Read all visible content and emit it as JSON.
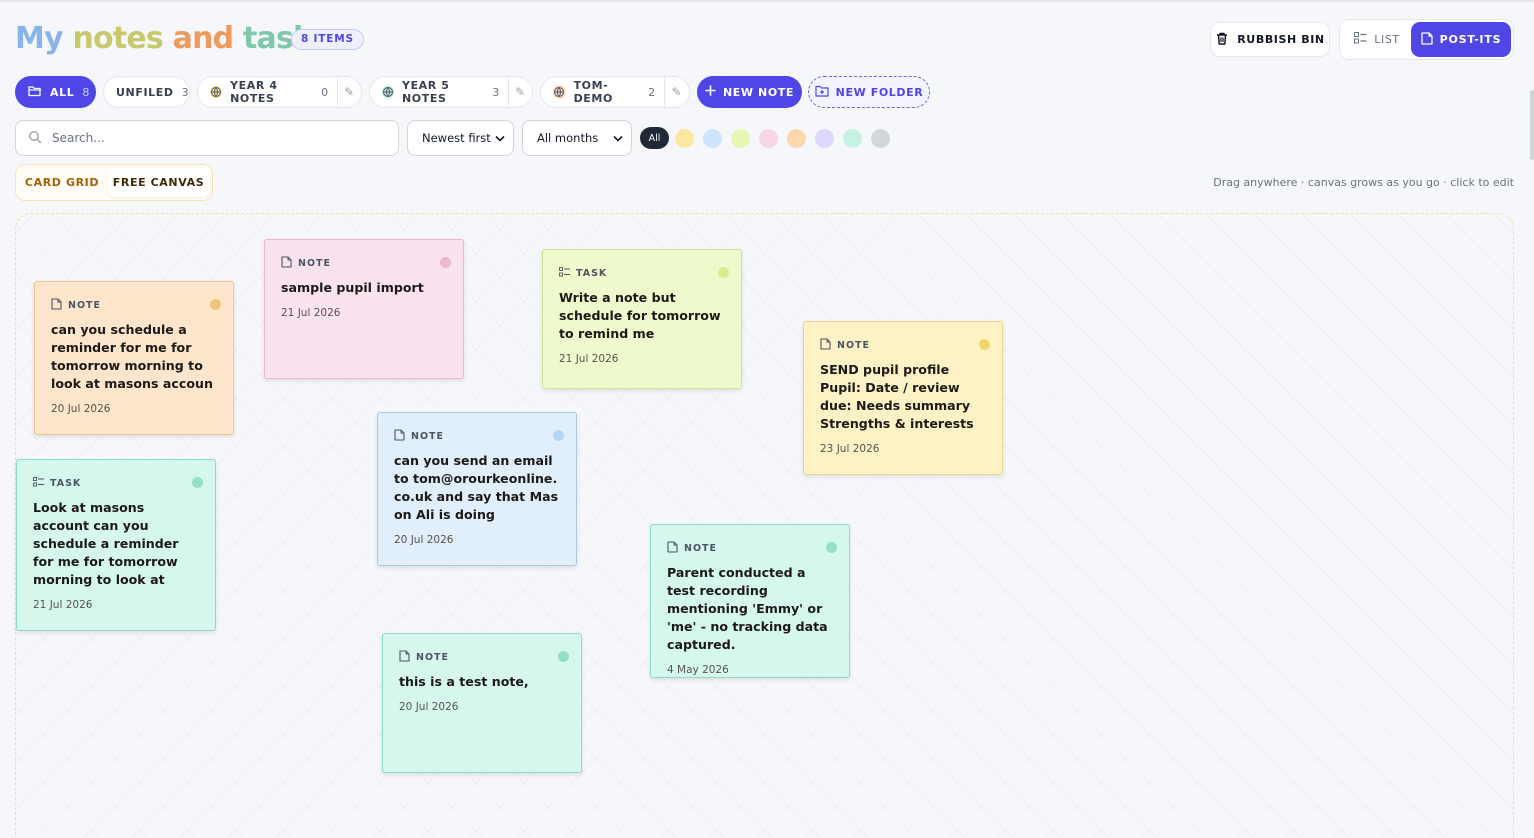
{
  "header": {
    "title_parts": [
      "My",
      "notes",
      "and",
      "tasks"
    ],
    "item_count": "8 ITEMS",
    "rubbish_bin_label": "RUBBISH BIN",
    "view_list_label": "LIST",
    "view_postits_label": "POST-ITS",
    "active_view": "POST-ITS"
  },
  "folders": {
    "all": {
      "label": "ALL",
      "count": "8"
    },
    "unfiled": {
      "label": "UNFILED",
      "count": "3"
    },
    "year4": {
      "label": "YEAR 4 NOTES",
      "count": "0"
    },
    "year5": {
      "label": "YEAR 5 NOTES",
      "count": "3"
    },
    "tomdemo": {
      "label": "TOM-DEMO",
      "count": "2"
    },
    "new_note_label": "NEW NOTE",
    "new_folder_label": "NEW FOLDER"
  },
  "filters": {
    "search_placeholder": "Search...",
    "sort_value": "Newest first",
    "month_value": "All months",
    "color_all_label": "All",
    "color_swatches": [
      "#fce7a3",
      "#cde4fb",
      "#e6f6b3",
      "#f9d6e6",
      "#fbd7ae",
      "#ddd7fb",
      "#c6f2e3",
      "#d4d6dd"
    ]
  },
  "layout_toggle": {
    "card_grid_label": "CARD GRID",
    "free_canvas_label": "FREE CANVAS",
    "active": "FREE CANVAS"
  },
  "hint": "Drag anywhere · canvas grows as you go · click to edit",
  "colors": {
    "accent": "#4f46e5"
  },
  "notes": [
    {
      "kind": "NOTE",
      "title": "can you schedule a reminder for me for tomorrow morning to look at masons accoun",
      "date": "20 Jul 2026",
      "dot": "#f1c47a"
    },
    {
      "kind": "NOTE",
      "title": "sample pupil import",
      "date": "21 Jul 2026",
      "dot": "#ebb8cd"
    },
    {
      "kind": "TASK",
      "title": "Write a note but schedule for tomorrow to remind me",
      "date": "21 Jul 2026",
      "dot": "#d9ec8e"
    },
    {
      "kind": "NOTE",
      "title": "SEND pupil profile Pupil: Date / review due: Needs summary Strengths & interests",
      "date": "23 Jul 2026",
      "dot": "#f0d66b"
    },
    {
      "kind": "NOTE",
      "title": "can you send an email to tom@orourkeonline.co.uk and say that Mason Ali is doing",
      "date": "20 Jul 2026",
      "dot": "#b7d5f5"
    },
    {
      "kind": "TASK",
      "title": "Look at masons account can you schedule a reminder for me for tomorrow morning to look at masons accoun",
      "date": "21 Jul 2026",
      "dot": "#94dfc7"
    },
    {
      "kind": "NOTE",
      "title": "Parent conducted a test recording mentioning 'Emmy' or 'me' - no tracking data captured.",
      "date": "4 May 2026",
      "dot": "#94dfc7"
    },
    {
      "kind": "NOTE",
      "title": "this is a test note,",
      "date": "20 Jul 2026",
      "dot": "#94dfc7"
    }
  ]
}
